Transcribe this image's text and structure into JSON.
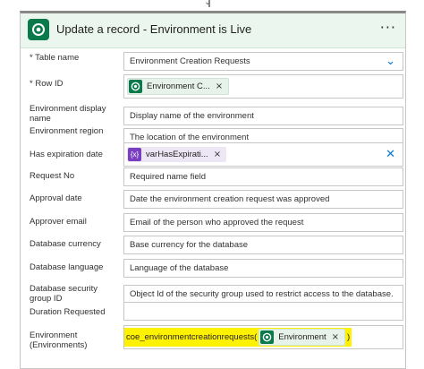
{
  "card": {
    "title": "Update a record - Environment is Live",
    "more_icon": "ellipsis-icon",
    "brand_icon": "dataverse-icon"
  },
  "rows": {
    "table_name": {
      "label": "* Table name",
      "value": "Environment Creation Requests"
    },
    "row_id": {
      "label": "* Row ID",
      "token": "Environment C..."
    },
    "env_display_name": {
      "label": "Environment display name",
      "value": "Display name of the environment"
    },
    "env_region": {
      "label": "Environment region",
      "value": "The location of the environment"
    },
    "has_expiration": {
      "label": "Has expiration date",
      "token": "varHasExpirati...",
      "token_icon": "{x}"
    },
    "request_no": {
      "label": "Request No",
      "value": "Required name field"
    },
    "approval_date": {
      "label": "Approval date",
      "value": "Date the environment creation request was approved"
    },
    "approver_email": {
      "label": "Approver email",
      "value": "Email of the person who approved the request"
    },
    "database_currency": {
      "label": "Database currency",
      "value": "Base currency for the database"
    },
    "database_language": {
      "label": "Database language",
      "value": "Language of the database"
    },
    "security_group": {
      "label": "Database security group ID",
      "value": "Object Id of the security group used to restrict access to the database."
    },
    "duration": {
      "label": "Duration Requested",
      "value": ""
    },
    "environment": {
      "label": "Environment (Environments)",
      "prefix": "coe_environmentcreationrequests(",
      "token": "Environment",
      "suffix": ")"
    }
  },
  "colors": {
    "accent": "#0078d4",
    "brand": "#0b7a4b",
    "variable": "#7a3fc0",
    "highlight": "#fff200"
  }
}
